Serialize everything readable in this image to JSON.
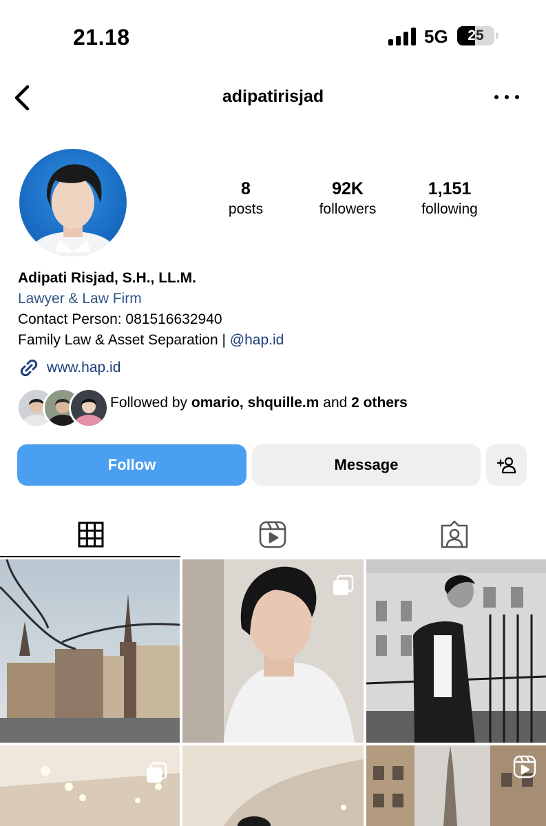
{
  "status_bar": {
    "time": "21.18",
    "network": "5G",
    "battery": "25"
  },
  "header": {
    "username": "adipatirisjad"
  },
  "stats": [
    {
      "value": "8",
      "label": "posts"
    },
    {
      "value": "92K",
      "label": "followers"
    },
    {
      "value": "1,151",
      "label": "following"
    }
  ],
  "bio": {
    "name": "Adipati Risjad, S.H., LL.M.",
    "category": "Lawyer & Law Firm",
    "contact": "Contact Person: 081516632940",
    "line": "Family Law & Asset Separation | ",
    "mention": "@hap.id",
    "website": "www.hap.id"
  },
  "followed_by": {
    "prefix": "Followed by ",
    "names": "omario, shquille.m",
    "middle": " and ",
    "others": "2 others"
  },
  "actions": {
    "follow": "Follow",
    "message": "Message"
  },
  "colors": {
    "follow_button": "#4a9ff0",
    "link": "#1c3e7a",
    "secondary_button": "#efefef"
  },
  "tabs": [
    {
      "name": "grid-icon",
      "active": true
    },
    {
      "name": "reels-icon",
      "active": false
    },
    {
      "name": "tagged-icon",
      "active": false
    }
  ]
}
